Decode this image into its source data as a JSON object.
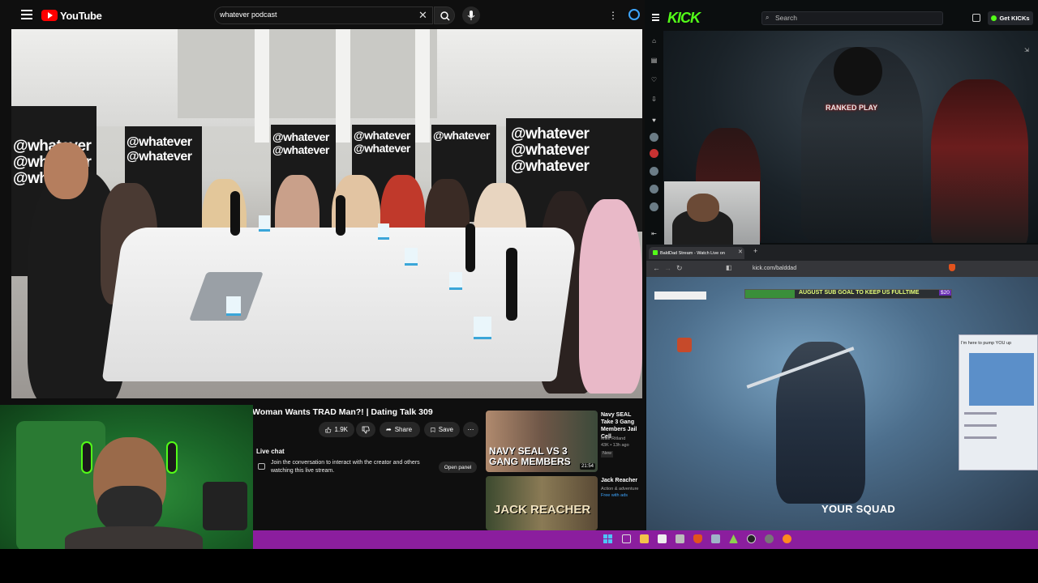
{
  "youtube": {
    "brand": "YouTube",
    "search_value": "whatever podcast",
    "video_title": "Woman Wants TRAD Man?! | Dating Talk 309",
    "like_count": "1.9K",
    "share_label": "Share",
    "save_label": "Save",
    "livechat_title": "Live chat",
    "livechat_desc": "Join the conversation to interact with the creator and others watching this live stream.",
    "open_panel_label": "Open panel",
    "wall_text": "@whatever",
    "sidebar": [
      {
        "title": "Navy SEAL Take 3 Gang Members Jail Cell",
        "channel": "Mike Ritland",
        "meta": "43K • 13h ago",
        "badge": "New",
        "duration": "21:54",
        "thumb_text": "NAVY SEAL VS 3 GANG MEMBERS"
      },
      {
        "title": "Jack Reacher",
        "channel": "Action & adventure",
        "meta": "Free with ads",
        "thumb_text": "JACK REACHER"
      }
    ]
  },
  "kick": {
    "logo": "KICK",
    "search_placeholder": "Search",
    "get_kicks_label": "Get KICKs",
    "tab_title": "BaldDad Stream - Watch Live on",
    "url": "kick.com/balddad",
    "sub_goal": "AUGUST SUB GOAL TO KEEP US FULLTIME",
    "sub_goal_amount": "$20",
    "sub_goal_progress": 0.24,
    "your_squad": "YOUR SQUAD",
    "popup_text": "I'm here to pump YOU up",
    "game_banner": "RANKED PLAY"
  },
  "colors": {
    "kick_green": "#53fc18",
    "youtube_red": "#ff0000",
    "taskbar": "#8b1e9e"
  }
}
